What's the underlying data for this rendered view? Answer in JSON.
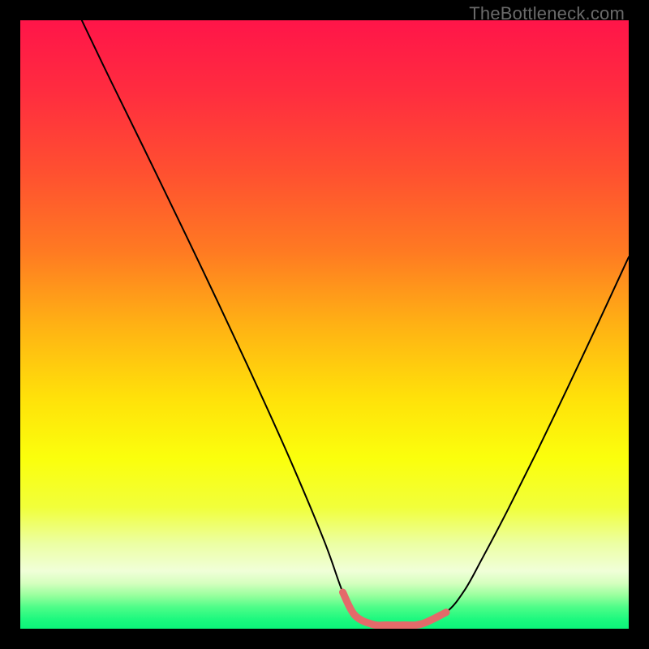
{
  "watermark": "TheBottleneck.com",
  "colors": {
    "bg_black": "#000000",
    "curve_stroke": "#000000",
    "bottom_segment": "#e46a6a",
    "gradient_stops": [
      {
        "offset": 0.0,
        "color": "#ff1549"
      },
      {
        "offset": 0.12,
        "color": "#ff2d3f"
      },
      {
        "offset": 0.25,
        "color": "#ff5030"
      },
      {
        "offset": 0.38,
        "color": "#ff7a22"
      },
      {
        "offset": 0.5,
        "color": "#ffb114"
      },
      {
        "offset": 0.62,
        "color": "#ffe10a"
      },
      {
        "offset": 0.72,
        "color": "#fbff0c"
      },
      {
        "offset": 0.8,
        "color": "#f1ff3a"
      },
      {
        "offset": 0.86,
        "color": "#ecffa3"
      },
      {
        "offset": 0.905,
        "color": "#f0ffd8"
      },
      {
        "offset": 0.925,
        "color": "#d6ffbf"
      },
      {
        "offset": 0.945,
        "color": "#99ff9e"
      },
      {
        "offset": 0.965,
        "color": "#4dfd88"
      },
      {
        "offset": 0.985,
        "color": "#1cf87e"
      },
      {
        "offset": 1.0,
        "color": "#0cf47a"
      }
    ]
  },
  "chart_data": {
    "type": "line",
    "title": "",
    "xlabel": "",
    "ylabel": "",
    "xlim": [
      0,
      100
    ],
    "ylim": [
      0,
      100
    ],
    "note": "V-shaped bottleneck curve over a red→yellow→green vertical gradient. x is a normalized component-balance axis, y is a bottleneck-severity-like value (higher = worse). Values read from pixel positions.",
    "series": [
      {
        "name": "curve",
        "x": [
          10.1,
          15,
          20,
          25,
          30,
          35,
          40,
          45,
          50,
          53,
          55,
          58,
          60,
          63,
          66,
          70,
          73,
          76,
          80,
          85,
          90,
          95,
          100
        ],
        "y": [
          100,
          89.8,
          79.6,
          69.3,
          58.9,
          48.3,
          37.5,
          26.3,
          14.3,
          6.0,
          2.2,
          0.7,
          0.6,
          0.6,
          0.8,
          2.7,
          6.3,
          11.7,
          19.3,
          29.3,
          39.7,
          50.3,
          61.1
        ]
      },
      {
        "name": "bottom-highlight",
        "x": [
          53,
          55,
          58,
          60,
          63,
          66,
          70
        ],
        "y": [
          6.0,
          2.2,
          0.7,
          0.6,
          0.6,
          0.8,
          2.7
        ]
      }
    ]
  }
}
